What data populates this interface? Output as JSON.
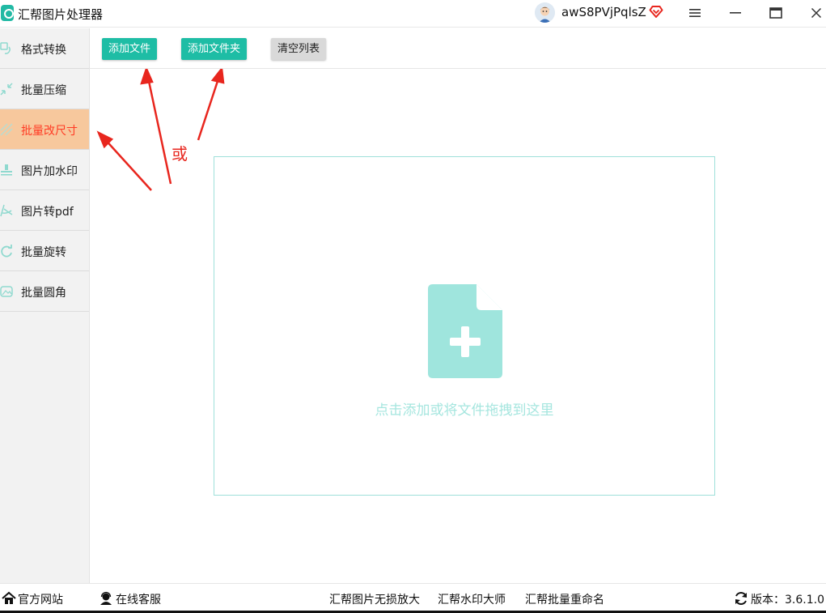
{
  "app": {
    "title": "汇帮图片处理器"
  },
  "user": {
    "name": "awS8PVjPqlsZ"
  },
  "sidebar": {
    "items": [
      {
        "label": "格式转换",
        "icon": "format-convert-icon",
        "active": false
      },
      {
        "label": "批量压缩",
        "icon": "compress-icon",
        "active": false
      },
      {
        "label": "批量改尺寸",
        "icon": "resize-icon",
        "active": true
      },
      {
        "label": "图片加水印",
        "icon": "watermark-icon",
        "active": false
      },
      {
        "label": "图片转pdf",
        "icon": "pdf-icon",
        "active": false
      },
      {
        "label": "批量旋转",
        "icon": "rotate-icon",
        "active": false
      },
      {
        "label": "批量圆角",
        "icon": "rounded-corner-icon",
        "active": false
      }
    ]
  },
  "toolbar": {
    "add_file": "添加文件",
    "add_folder": "添加文件夹",
    "clear_list": "清空列表"
  },
  "annotation": {
    "or": "或"
  },
  "dropzone": {
    "hint": "点击添加或将文件拖拽到这里"
  },
  "footer": {
    "website": "官方网站",
    "support": "在线客服",
    "link1": "汇帮图片无损放大",
    "link2": "汇帮水印大师",
    "link3": "汇帮批量重命名",
    "version_label": "版本：3.6.1.0"
  },
  "colors": {
    "accent": "#1ebda5",
    "active_bg": "#f7c89d",
    "active_text": "#ff3b24",
    "annotation": "#e8261e",
    "drop_hint": "#a6e6df"
  }
}
